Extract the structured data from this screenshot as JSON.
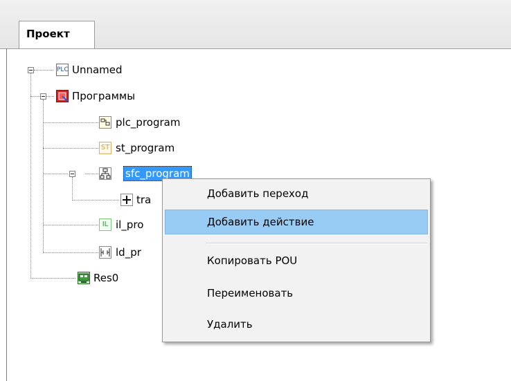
{
  "tab": {
    "label": "Проект"
  },
  "tree": {
    "root": {
      "label": "Unnamed",
      "icon": "plc-icon"
    },
    "programs": {
      "label": "Программы",
      "icon": "programs-icon"
    },
    "plc_program": {
      "label": "plc_program",
      "icon": "fbd-icon"
    },
    "st_program": {
      "label": "st_program",
      "icon": "st-icon",
      "icon_text": "ST"
    },
    "sfc_program": {
      "label": "sfc_program",
      "icon": "sfc-icon"
    },
    "transition": {
      "label": "tra",
      "icon": "transition-icon"
    },
    "il_program": {
      "label": "il_pro",
      "icon": "il-icon",
      "icon_text": "IL"
    },
    "ld_program": {
      "label": "ld_pr",
      "icon": "ld-icon"
    },
    "resource": {
      "label": "Res0",
      "icon": "resource-icon"
    }
  },
  "context_menu": {
    "items": [
      {
        "label": "Добавить переход"
      },
      {
        "label": "Добавить действие"
      },
      {
        "label": "Копировать POU"
      },
      {
        "label": "Переименовать"
      },
      {
        "label": "Удалить"
      }
    ]
  }
}
